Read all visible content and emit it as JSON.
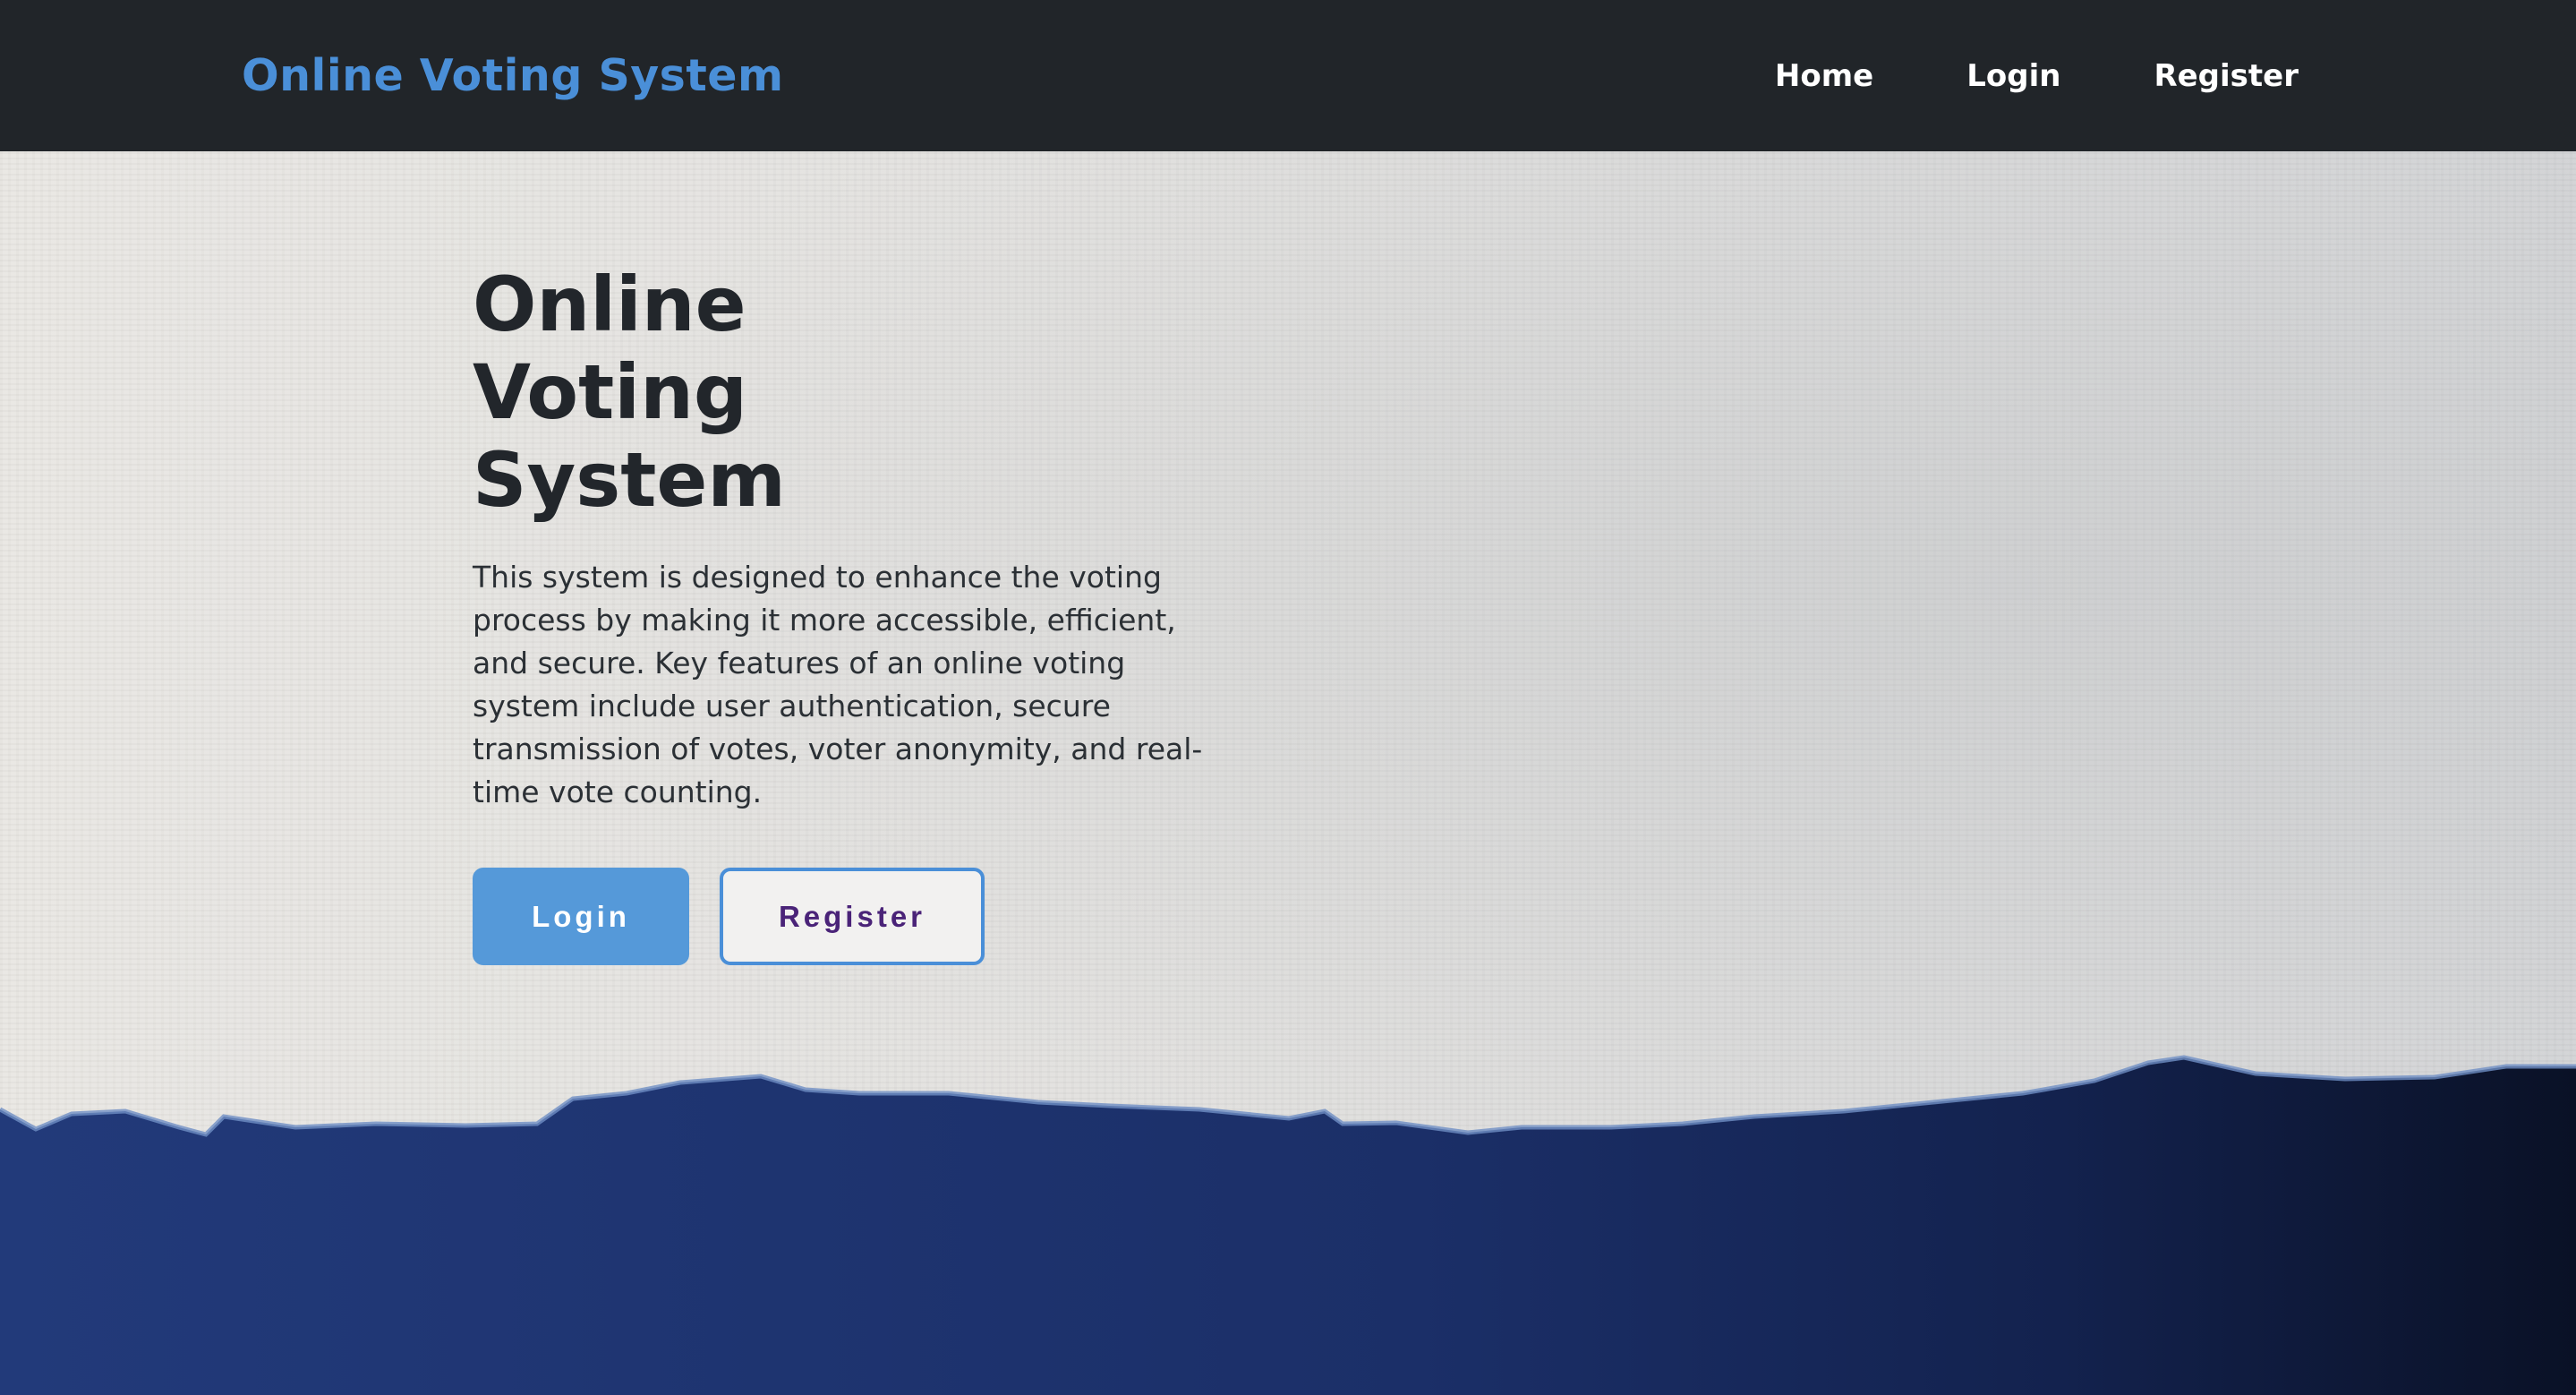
{
  "navbar": {
    "brand": "Online Voting System",
    "links": [
      {
        "label": "Home"
      },
      {
        "label": "Login"
      },
      {
        "label": "Register"
      }
    ]
  },
  "hero": {
    "title": "Online Voting System",
    "description": "This system is designed to enhance the voting process by making it more accessible, efficient, and secure. Key features of an online voting system include user authentication, secure transmission of votes, voter anonymity, and real-time vote counting.",
    "login_label": "Login",
    "register_label": "Register"
  },
  "colors": {
    "navbar_bg": "#212529",
    "brand": "#4a8fd8",
    "primary_button": "#5599d9",
    "register_text": "#4a2378",
    "footer_band": "#1c2f6b"
  }
}
